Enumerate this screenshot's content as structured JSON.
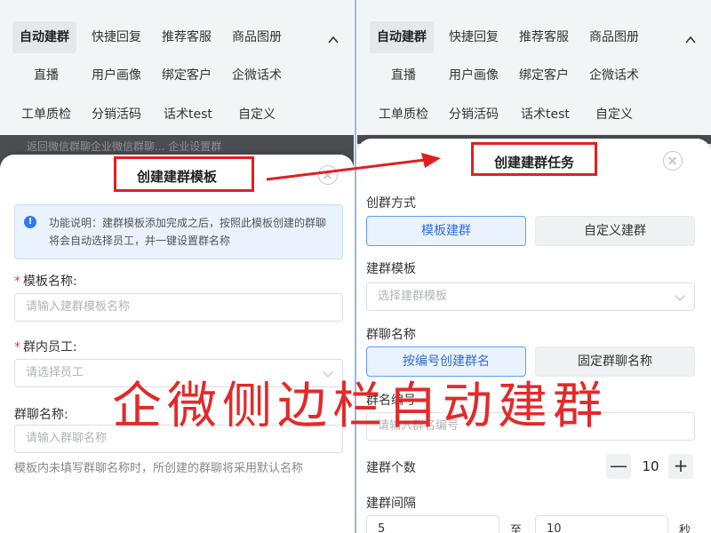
{
  "menu": {
    "row1": [
      "自动建群",
      "快捷回复",
      "推荐客服",
      "商品图册"
    ],
    "row2": [
      "直播",
      "用户画像",
      "绑定客户",
      "企微话术"
    ],
    "row3": [
      "工单质检",
      "分销活码",
      "话术test",
      "自定义"
    ],
    "active": "自动建群",
    "collapse_icon": "chevron-up-icon"
  },
  "background_strip_text": "返回微信群聊企业微信群聊... 企业设置群",
  "left": {
    "title": "创建建群模板",
    "notice": "功能说明：建群模板添加完成之后，按照此模板创建的群聊将会自动选择员工，并一键设置群名称",
    "template_name": {
      "label": "模板名称:",
      "placeholder": "请输入建群模板名称"
    },
    "staff": {
      "label": "群内员工:",
      "placeholder": "请选择员工"
    },
    "group_name": {
      "label": "群聊名称:",
      "placeholder": "请输入群聊名称"
    },
    "hint": "模板内未填写群聊名称时，所创建的群聊将采用默认名称"
  },
  "right": {
    "title": "创建建群任务",
    "method": {
      "label": "创群方式",
      "options": [
        "模板建群",
        "自定义建群"
      ],
      "selected": "模板建群"
    },
    "template": {
      "label": "建群模板",
      "placeholder": "选择建群模板"
    },
    "group_name": {
      "label": "群聊名称",
      "options": [
        "按编号创建群名",
        "固定群聊名称"
      ],
      "selected": "按编号创建群名"
    },
    "number": {
      "label": "群名编号",
      "placeholder": "请输入群名编号"
    },
    "count": {
      "label": "建群个数",
      "value": "10",
      "minus": "—",
      "plus": "+"
    },
    "interval": {
      "label": "建群间隔",
      "from": "5",
      "to_label": "至",
      "to": "10",
      "unit": "秒"
    }
  },
  "caption": "企微侧边栏自动建群",
  "colors": {
    "annotation_red": "#e02020",
    "accent_blue": "#2e7bf0",
    "panel_gray": "#f3f4f6"
  }
}
